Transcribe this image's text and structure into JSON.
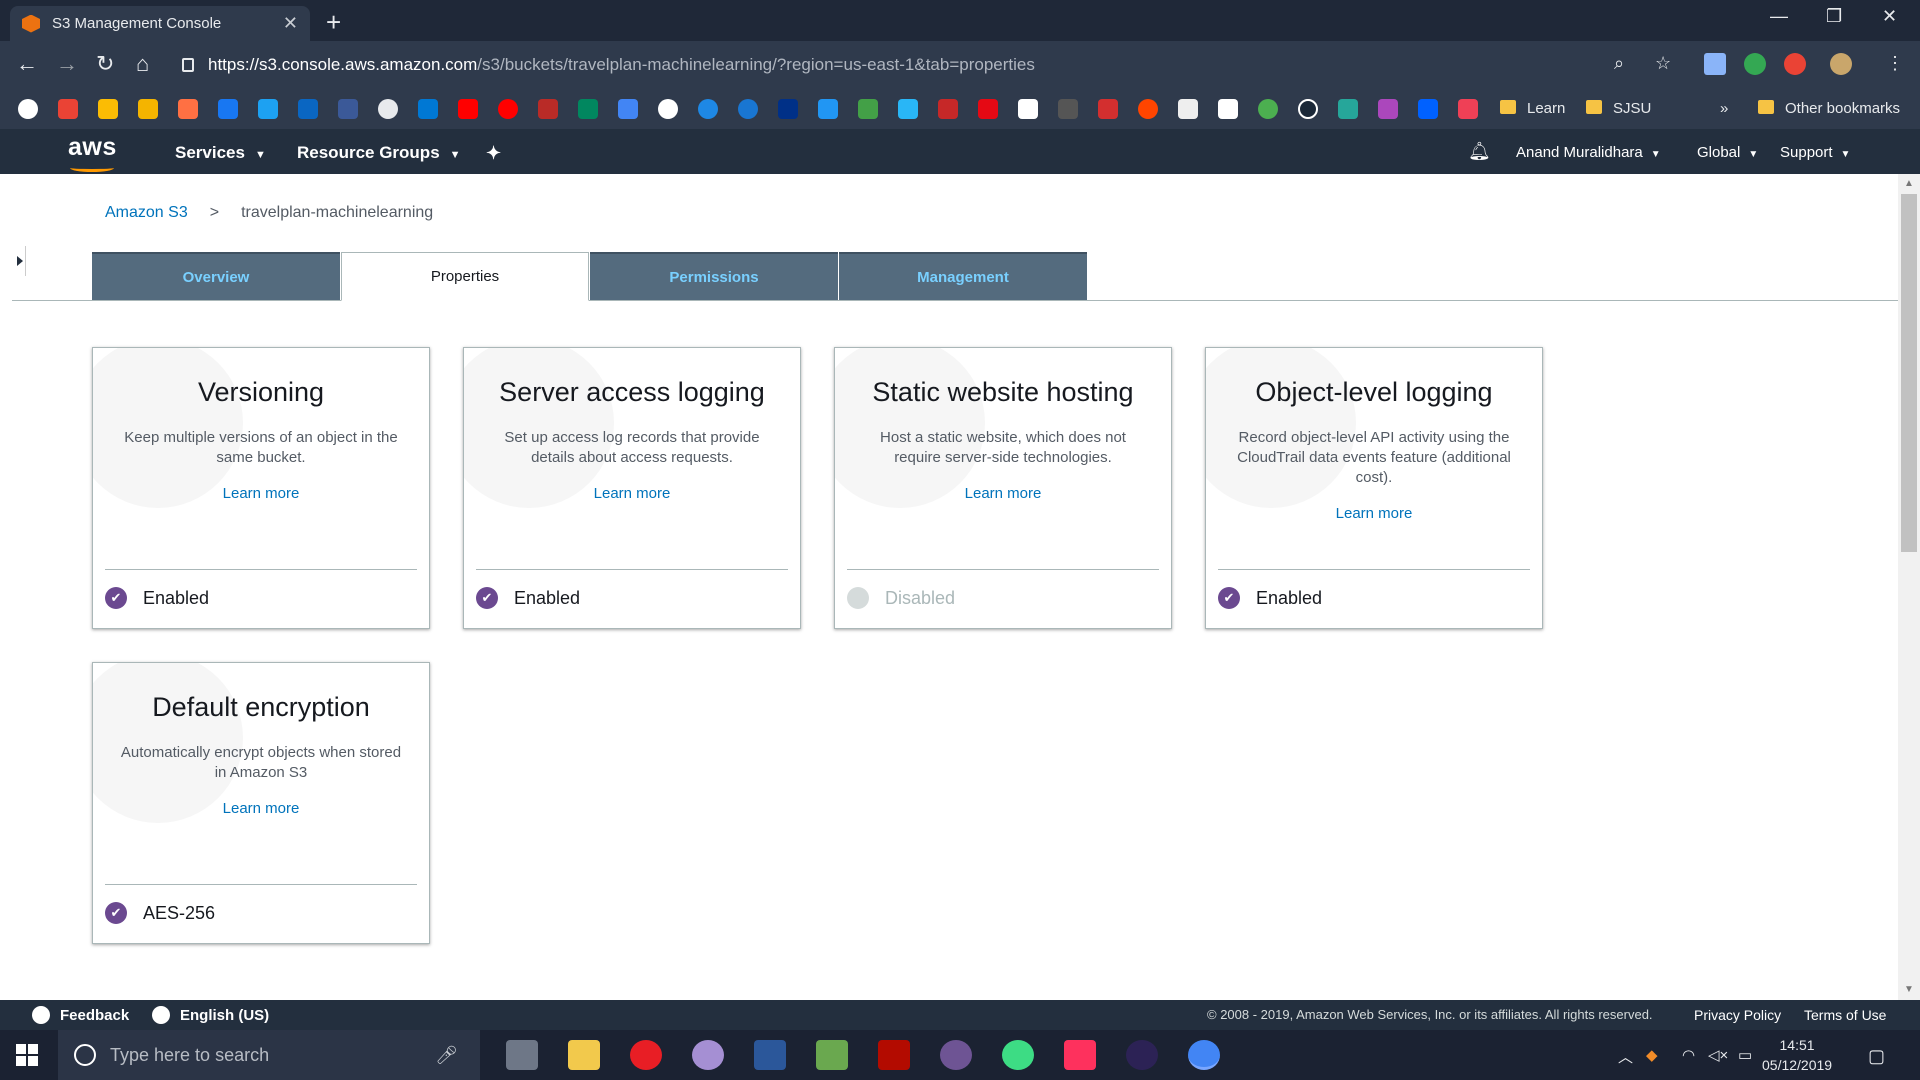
{
  "browser": {
    "tab_title": "S3 Management Console",
    "tab_close": "✕",
    "new_tab": "+",
    "url_host": "https://s3.console.aws.amazon.com",
    "url_path": "/s3/buckets/travelplan-machinelearning/?region=us-east-1&tab=properties",
    "window_controls": [
      "—",
      "❐",
      "✕"
    ],
    "bookmarks": {
      "folder_learn": "Learn",
      "folder_sjsu": "SJSU",
      "overflow": "»",
      "other": "Other bookmarks"
    }
  },
  "aws_nav": {
    "logo": "aws",
    "services": "Services",
    "resource_groups": "Resource Groups",
    "user": "Anand Muralidhara",
    "region": "Global",
    "support": "Support"
  },
  "breadcrumb": {
    "root": "Amazon S3",
    "separator": ">",
    "current": "travelplan-machinelearning"
  },
  "tabs": [
    "Overview",
    "Properties",
    "Permissions",
    "Management"
  ],
  "cards": [
    {
      "title": "Versioning",
      "description": "Keep multiple versions of an object in the same bucket.",
      "learn_more": "Learn more",
      "status": "Enabled"
    },
    {
      "title": "Server access logging",
      "description": "Set up access log records that provide details about access requests.",
      "learn_more": "Learn more",
      "status": "Enabled"
    },
    {
      "title": "Static website hosting",
      "description": "Host a static website, which does not require server-side technologies.",
      "learn_more": "Learn more",
      "status": "Disabled"
    },
    {
      "title": "Object-level logging",
      "description": "Record object-level API activity using the CloudTrail data events feature (additional cost).",
      "learn_more": "Learn more",
      "status": "Enabled"
    },
    {
      "title": "Default encryption",
      "description": "Automatically encrypt objects when stored in Amazon S3",
      "learn_more": "Learn more",
      "status": "AES-256"
    }
  ],
  "footer": {
    "feedback": "Feedback",
    "language": "English (US)",
    "copyright": "© 2008 - 2019, Amazon Web Services, Inc. or its affiliates. All rights reserved.",
    "privacy": "Privacy Policy",
    "terms": "Terms of Use"
  },
  "taskbar": {
    "search_placeholder": "Type here to search",
    "time": "14:51",
    "date": "05/12/2019"
  },
  "colors": {
    "aws_dark": "#232f3e",
    "tab_inactive": "#546b7e",
    "link": "#0073bb",
    "enabled_check": "#6b4990"
  }
}
